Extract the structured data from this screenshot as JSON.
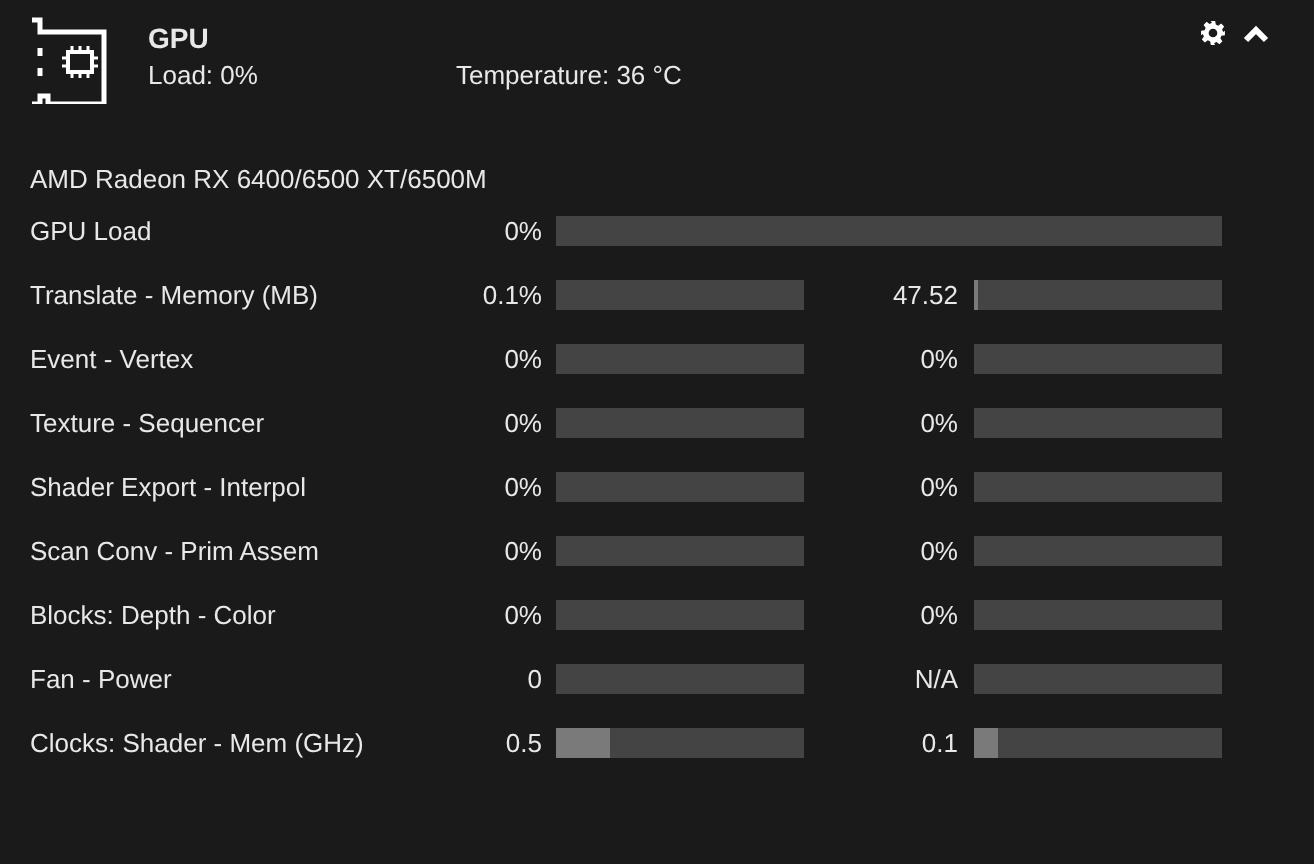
{
  "header": {
    "title": "GPU",
    "load": "Load: 0%",
    "temperature": "Temperature: 36 °C"
  },
  "device": "AMD Radeon RX 6400/6500 XT/6500M",
  "rows": [
    {
      "kind": "single",
      "label": "GPU Load",
      "meters": [
        {
          "value": "0%"
        }
      ]
    },
    {
      "kind": "double",
      "label": "Translate - Memory (MB)",
      "meters": [
        {
          "value": "0.1%"
        },
        {
          "value": "47.52",
          "level": 0.015
        }
      ]
    },
    {
      "kind": "double",
      "label": "Event - Vertex",
      "meters": [
        {
          "value": "0%"
        },
        {
          "value": "0%"
        }
      ]
    },
    {
      "kind": "double",
      "label": "Texture - Sequencer",
      "meters": [
        {
          "value": "0%"
        },
        {
          "value": "0%"
        }
      ]
    },
    {
      "kind": "double",
      "label": "Shader Export - Interpol",
      "meters": [
        {
          "value": "0%"
        },
        {
          "value": "0%"
        }
      ]
    },
    {
      "kind": "double",
      "label": "Scan Conv - Prim Assem",
      "meters": [
        {
          "value": "0%"
        },
        {
          "value": "0%"
        }
      ]
    },
    {
      "kind": "double",
      "label": "Blocks: Depth - Color",
      "meters": [
        {
          "value": "0%"
        },
        {
          "value": "0%"
        }
      ]
    },
    {
      "kind": "double",
      "label": "Fan - Power",
      "meters": [
        {
          "value": "0"
        },
        {
          "value": "N/A"
        }
      ]
    },
    {
      "kind": "double",
      "label": "Clocks: Shader - Mem (GHz)",
      "meters": [
        {
          "value": "0.5",
          "level": 0.22
        },
        {
          "value": "0.1",
          "level": 0.1
        }
      ]
    }
  ]
}
